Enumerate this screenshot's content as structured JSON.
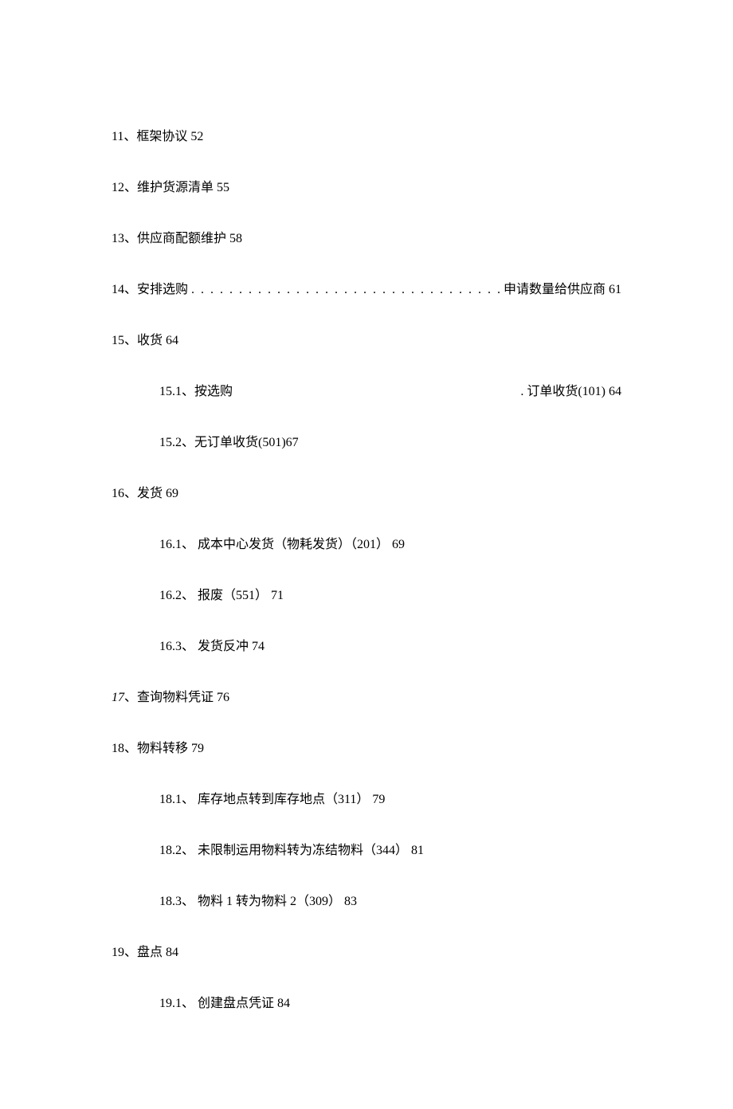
{
  "items": {
    "l11": "11、框架协议 52",
    "l12": "12、维护货源清单 55",
    "l13": "13、供应商配额维护 58",
    "l14_lead": "14、安排选购",
    "l14_dots": ". . . . . . . . . . . . . . . . . . . . . . . . . . . . . . . . . . . . . . . . . . . .",
    "l14_trail": "申请数量给供应商 61",
    "l15": "15、收货 64",
    "l15_1_left": "15.1、按选购",
    "l15_1_right": ". 订单收货(101) 64",
    "l15_2": "15.2、无订单收货(501)67",
    "l16": "16、发货 69",
    "l16_1": "16.1、 成本中心发货（物耗发货）（201） 69",
    "l16_2": "16.2、 报废（551） 71",
    "l16_3": "16.3、 发货反冲 74",
    "l17_num": "17",
    "l17_rest": "、查询物料凭证 76",
    "l18": "18、物料转移 79",
    "l18_1": "18.1、 库存地点转到库存地点（311） 79",
    "l18_2": "18.2、 未限制运用物料转为冻结物料（344） 81",
    "l18_3": "18.3、 物料 1 转为物料 2（309） 83",
    "l19": "19、盘点 84",
    "l19_1": "19.1、 创建盘点凭证 84"
  }
}
